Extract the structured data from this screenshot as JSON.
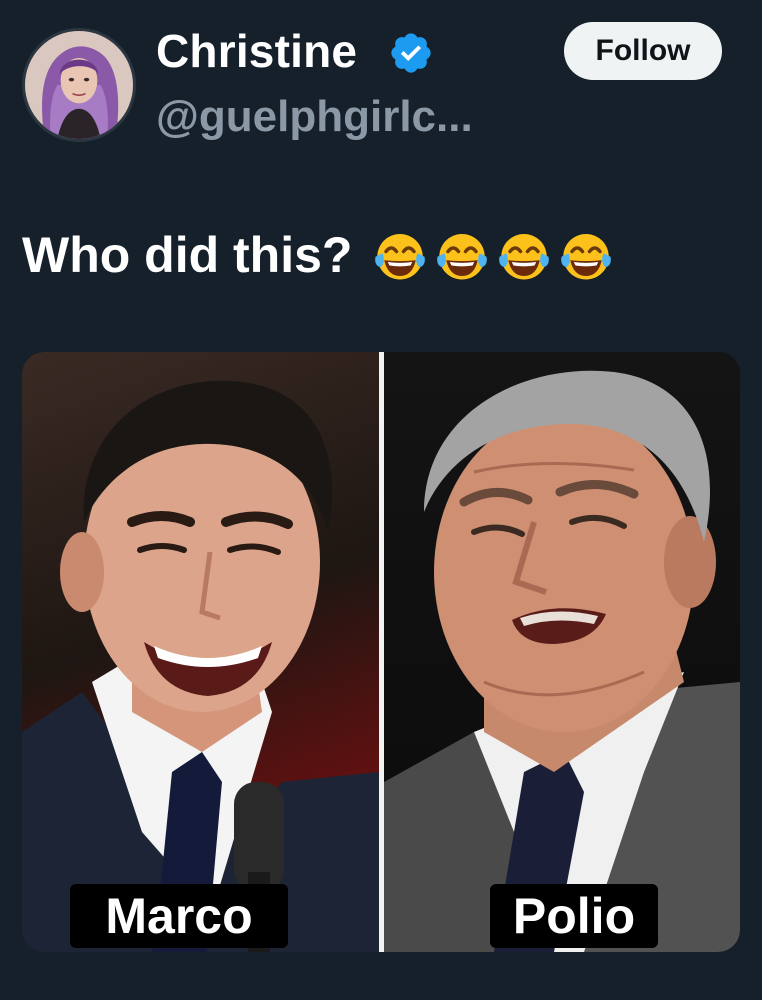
{
  "author": {
    "display_name": "Christine",
    "handle": "@guelphgirlc...",
    "verified": true,
    "verified_color": "#1d9bf0"
  },
  "follow_button": {
    "label": "Follow"
  },
  "tweet": {
    "text": "Who did this?",
    "emojis": [
      "face-with-tears-of-joy-icon",
      "face-with-tears-of-joy-icon",
      "face-with-tears-of-joy-icon",
      "face-with-tears-of-joy-icon"
    ]
  },
  "media": {
    "left_caption": "Marco",
    "right_caption": "Polio"
  },
  "colors": {
    "background": "#15202b",
    "handle": "#8b98a5",
    "button_bg": "#eff3f4"
  }
}
